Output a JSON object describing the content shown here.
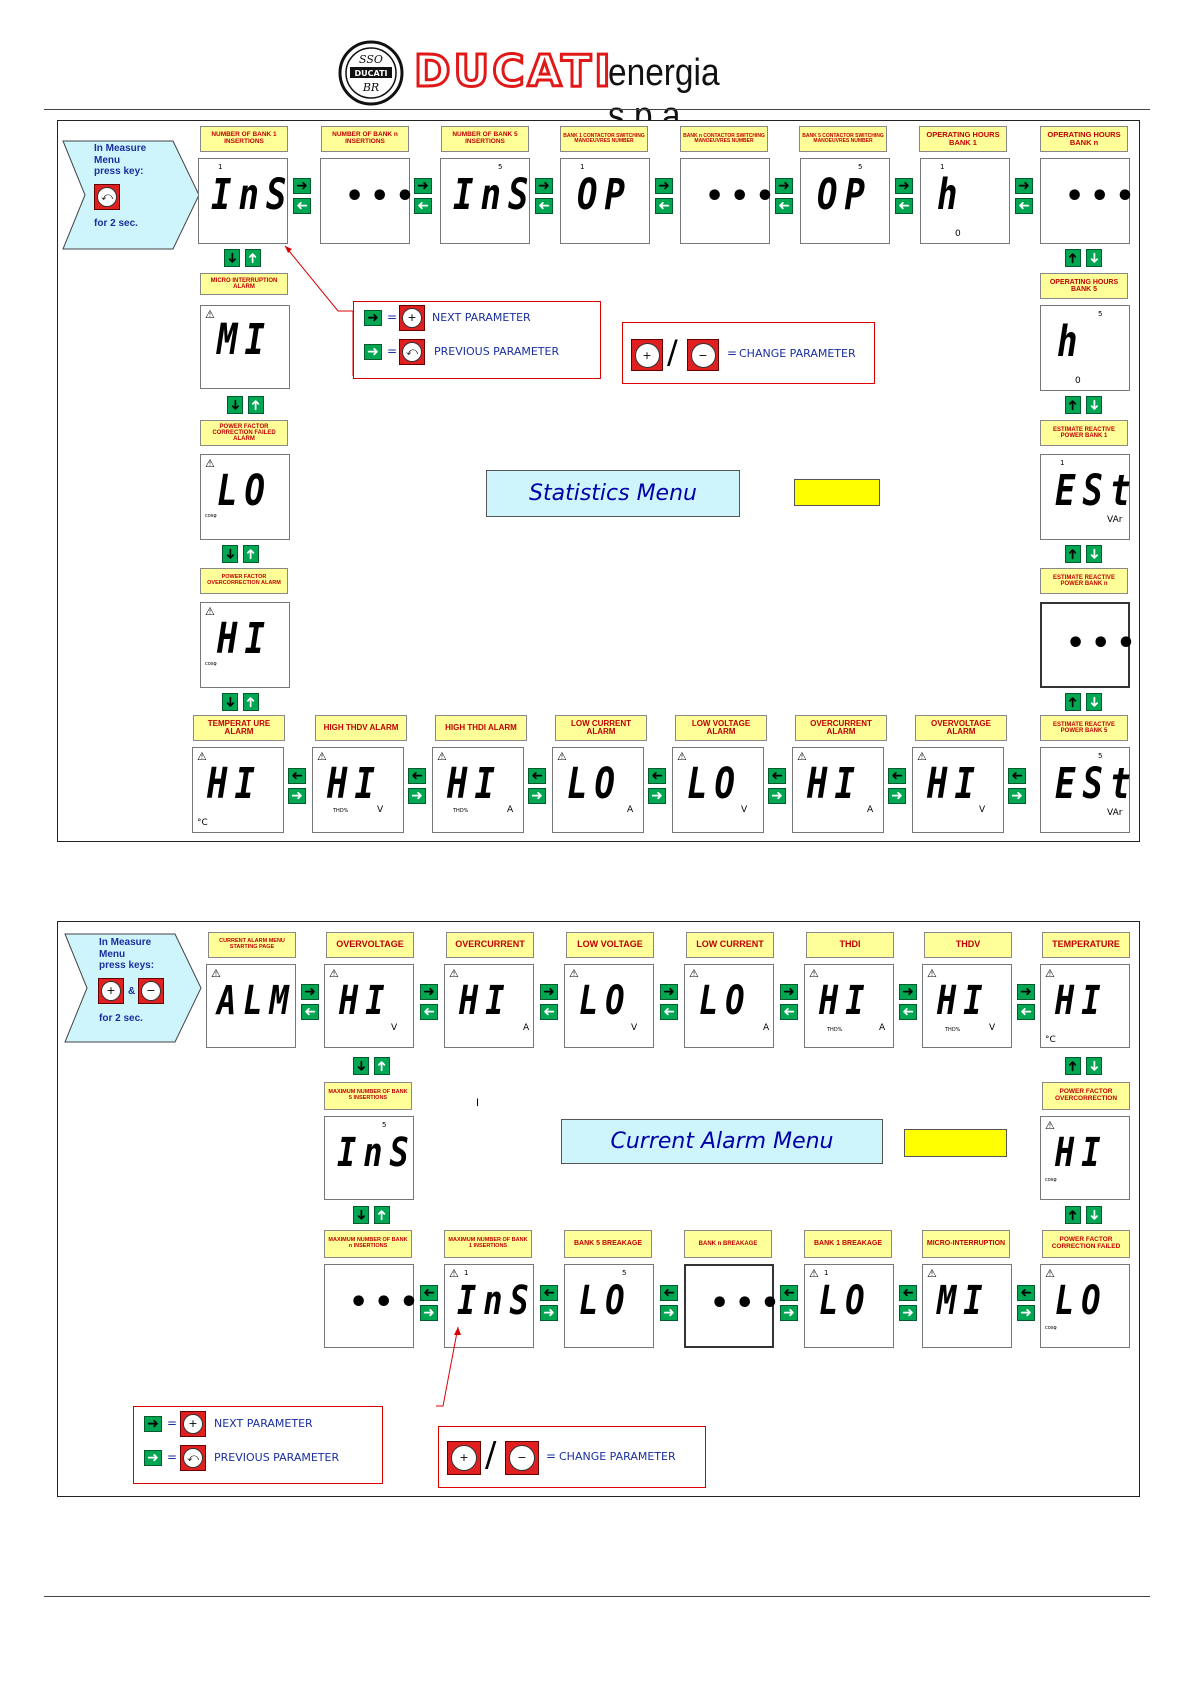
{
  "header": {
    "logo_text": "DUCATI",
    "company": "energia s.p.a."
  },
  "keys": {
    "eq": "=",
    "slash": "/",
    "amp": "&",
    "back_glyph": "⤺",
    "plus_glyph": "+",
    "minus_glyph": "−"
  },
  "stats": {
    "menu_title": "Statistics Menu",
    "intro": {
      "l1": "In Measure",
      "l2": "Menu",
      "l3": "press key:",
      "l4": "for 2 sec."
    },
    "labels": {
      "bank1_ins": "NUMBER OF BANK 1 INSERTIONS",
      "bankn_ins": "NUMBER OF BANK n INSERTIONS",
      "bank5_ins": "NUMBER OF BANK 5 INSERTIONS",
      "bank1_op": "BANK 1 CONTACTOR SWITCHING MANOEUVRES NUMBER",
      "bankn_op": "BANK n CONTACTOR SWITCHING MANOEUVRES NUMBER",
      "bank5_op": "BANK 5 CONTACTOR SWITCHING MANOEUVRES NUMBER",
      "hours1": "OPERATING HOURS BANK 1",
      "hoursn": "OPERATING HOURS BANK n",
      "hours5": "OPERATING HOURS BANK 5",
      "est1": "ESTIMATE REACTIVE POWER BANK 1",
      "estn": "ESTIMATE REACTIVE POWER BANK n",
      "est5": "ESTIMATE REACTIVE POWER BANK 5",
      "micro": "MICRO INTERRUPTION ALARM",
      "pf_fail": "POWER FACTOR CORRECTION FAILED ALARM",
      "pf_over": "POWER FACTOR OVERCORRECTION ALARM",
      "temp": "TEMPERAT URE ALARM",
      "thdv": "HIGH THDV ALARM",
      "thdi": "HIGH THDI ALARM",
      "lowc": "LOW CURRENT ALARM",
      "lowv": "LOW VOLTAGE ALARM",
      "overc": "OVERCURRENT ALARM",
      "overv": "OVERVOLTAGE ALARM"
    },
    "legend": {
      "next": "NEXT PARAMETER",
      "prev": "PREVIOUS PARAMETER",
      "change": "CHANGE PARAMETER"
    }
  },
  "alarm": {
    "menu_title": "Current Alarm Menu",
    "intro": {
      "l1": "In Measure",
      "l2": "Menu",
      "l3": "press keys:",
      "l4": "for 2 sec."
    },
    "labels": {
      "start": "CURRENT ALARM MENU STARTING PAGE",
      "overv": "OVERVOLTAGE",
      "overc": "OVERCURRENT",
      "lowv": "LOW VOLTAGE",
      "lowc": "LOW CURRENT",
      "thdi": "THDI",
      "thdv": "THDV",
      "temp": "TEMPERATURE",
      "max5": "MAXIMUM NUMBER OF BANK 5 INSERTIONS",
      "pf_over": "POWER FACTOR OVERCORRECTION",
      "maxn": "MAXIMUM NUMBER OF BANK n INSERTIONS",
      "max1": "MAXIMUM NUMBER OF BANK 1 INSERTIONS",
      "b5brk": "BANK 5 BREAKAGE",
      "bnbrk": "BANK n BREAKAGE",
      "b1brk": "BANK 1 BREAKAGE",
      "micro": "MICRO-INTERRUPTION",
      "pf_fail": "POWER FACTOR CORRECTION FAILED"
    },
    "stray_mark": "I",
    "legend": {
      "next": "NEXT PARAMETER",
      "prev": "PREVIOUS PARAMETER",
      "change": "CHANGE PARAMETER"
    }
  },
  "lcd": {
    "ins": "InS",
    "op": "OP",
    "h": "h",
    "est": "ESt",
    "mi": "MI",
    "lo": "LO",
    "hi": "HI",
    "aln": "ALM",
    "dots": "•••",
    "unit_var": "VAr",
    "unit_v": "V",
    "unit_a": "A",
    "unit_c": "°C",
    "unit_thd": "THD%",
    "unit_cos": "cosφ",
    "warn": "⚠",
    "sub1": "1",
    "sub5": "5",
    "subzero": "0"
  },
  "colors": {
    "brand": "#e01818",
    "arrow": "#00a651",
    "title_bg": "#cdf5fb",
    "label_bg": "#ffff99",
    "legend_border": "#dd0000"
  }
}
